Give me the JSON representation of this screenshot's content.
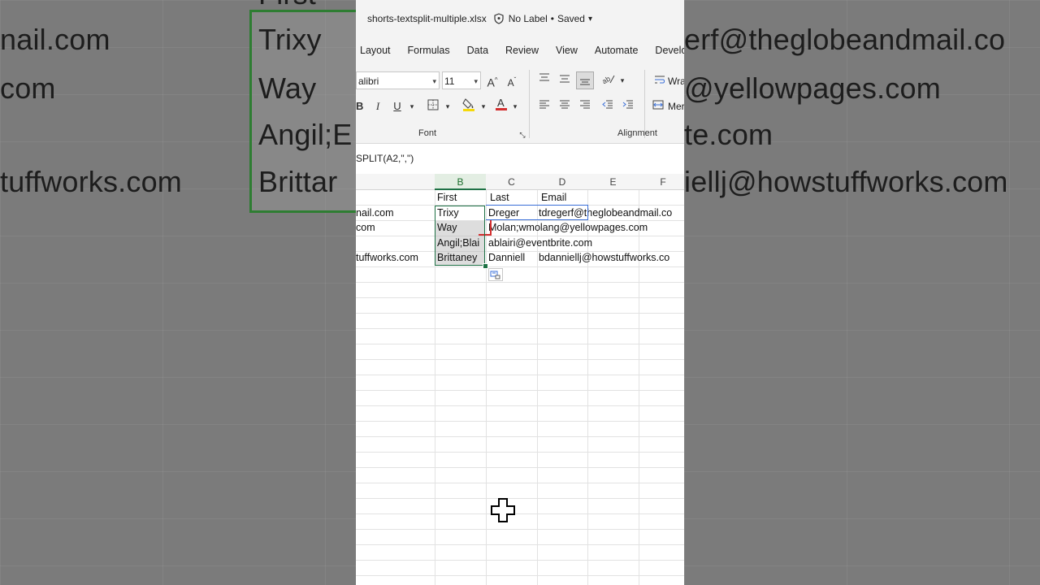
{
  "window": {
    "filename": "shorts-textsplit-multiple.xlsx",
    "sensitivity": "No Label",
    "saved": "Saved"
  },
  "ribbon_tabs": [
    "Layout",
    "Formulas",
    "Data",
    "Review",
    "View",
    "Automate",
    "Develo"
  ],
  "ribbon": {
    "font_name": "alibri",
    "font_size": "11",
    "font_group": "Font",
    "alignment_group": "Alignment",
    "wrap_label": "Wra",
    "merge_label": "Mer",
    "bold": "B",
    "italic": "I",
    "underline": "U"
  },
  "formula_bar": {
    "text": "SPLIT(A2,\",\")"
  },
  "columns": [
    "B",
    "C",
    "D",
    "E",
    "F"
  ],
  "rows": [
    {
      "a": "",
      "b": "First",
      "c": "Last",
      "d": "Email"
    },
    {
      "a": "nail.com",
      "b": "Trixy",
      "c": "Dreger",
      "d": "tdregerf@theglobeandmail.co"
    },
    {
      "a": "com",
      "b": "Way",
      "c": "Molan;wmolang@yellowpages.com",
      "d": ""
    },
    {
      "a": "",
      "b": "Angil;Blai",
      "c": "ablairi@eventbrite.com",
      "d": ""
    },
    {
      "a": "tuffworks.com",
      "b": "Brittaney",
      "c": "Danniell",
      "d": "bdanniellj@howstuffworks.co"
    }
  ],
  "background_left": [
    "nail.com",
    "com",
    "tuffworks.com",
    "First",
    "Trixy",
    "Way",
    "Angil;E",
    "Brittar"
  ],
  "background_right": [
    "erf@theglobeandmail.co",
    "@yellowpages.com",
    "te.com",
    "iellj@howstuffworks.com"
  ],
  "colors": {
    "excel_green": "#1e7145",
    "selection_blue": "#3a6fd8",
    "font_red": "#d32f2f",
    "highlight_yellow": "#f5d90a"
  }
}
